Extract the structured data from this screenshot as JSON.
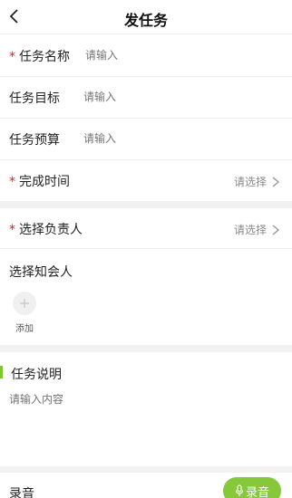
{
  "header": {
    "title": "发任务",
    "back_icon": "chevron-left-icon"
  },
  "form": {
    "task_name": {
      "required_mark": "*",
      "label": "任务名称",
      "placeholder": "请输入"
    },
    "task_goal": {
      "label": "任务目标",
      "placeholder": "请输入"
    },
    "task_budget": {
      "label": "任务预算",
      "placeholder": "请输入"
    },
    "finish_time": {
      "required_mark": "*",
      "label": "完成时间",
      "value": "请选择",
      "arrow_icon": "chevron-right-icon"
    },
    "assignee": {
      "required_mark": "*",
      "label": "选择负责人",
      "value": "请选择",
      "arrow_icon": "chevron-right-icon"
    },
    "cc": {
      "label": "选择知会人",
      "add_label": "添加",
      "add_icon": "plus-icon"
    },
    "description": {
      "label": "任务说明",
      "placeholder": "请输入内容"
    },
    "recording": {
      "label": "录音",
      "button_label": "录音",
      "button_icon": "microphone-icon"
    }
  },
  "colors": {
    "accent": "#86c83a",
    "required": "#e02020",
    "section_gap": "#f2f2f2"
  }
}
